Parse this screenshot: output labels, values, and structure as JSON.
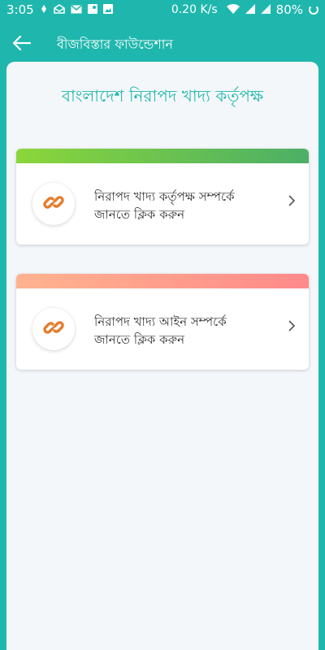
{
  "status_bar": {
    "time": "3:05",
    "network_speed": "0.20 K/s",
    "battery": "80%"
  },
  "app_bar": {
    "title": "বীজবিস্তার ফাউন্ডেশান",
    "back_icon": "arrow-left-icon"
  },
  "page": {
    "title": "বাংলাদেশ নিরাপদ খাদ্য কর্তৃপক্ষ"
  },
  "cards": [
    {
      "line1": "নিরাপদ খাদ্য কর্তৃপক্ষ সম্পর্কে",
      "line2": "জানতে ক্লিক করুন",
      "icon": "link-icon",
      "strip_colors": [
        "#8bd63a",
        "#4caf66"
      ]
    },
    {
      "line1": "নিরাপদ খাদ্য আইন সম্পর্কে",
      "line2": "জানতে ক্লিক করুন",
      "icon": "link-icon",
      "strip_colors": [
        "#ffb38f",
        "#ff8a8a"
      ]
    }
  ],
  "colors": {
    "primary": "#1fb7ad",
    "background": "#f4f7fa",
    "link_icon": "#e47c2c"
  }
}
